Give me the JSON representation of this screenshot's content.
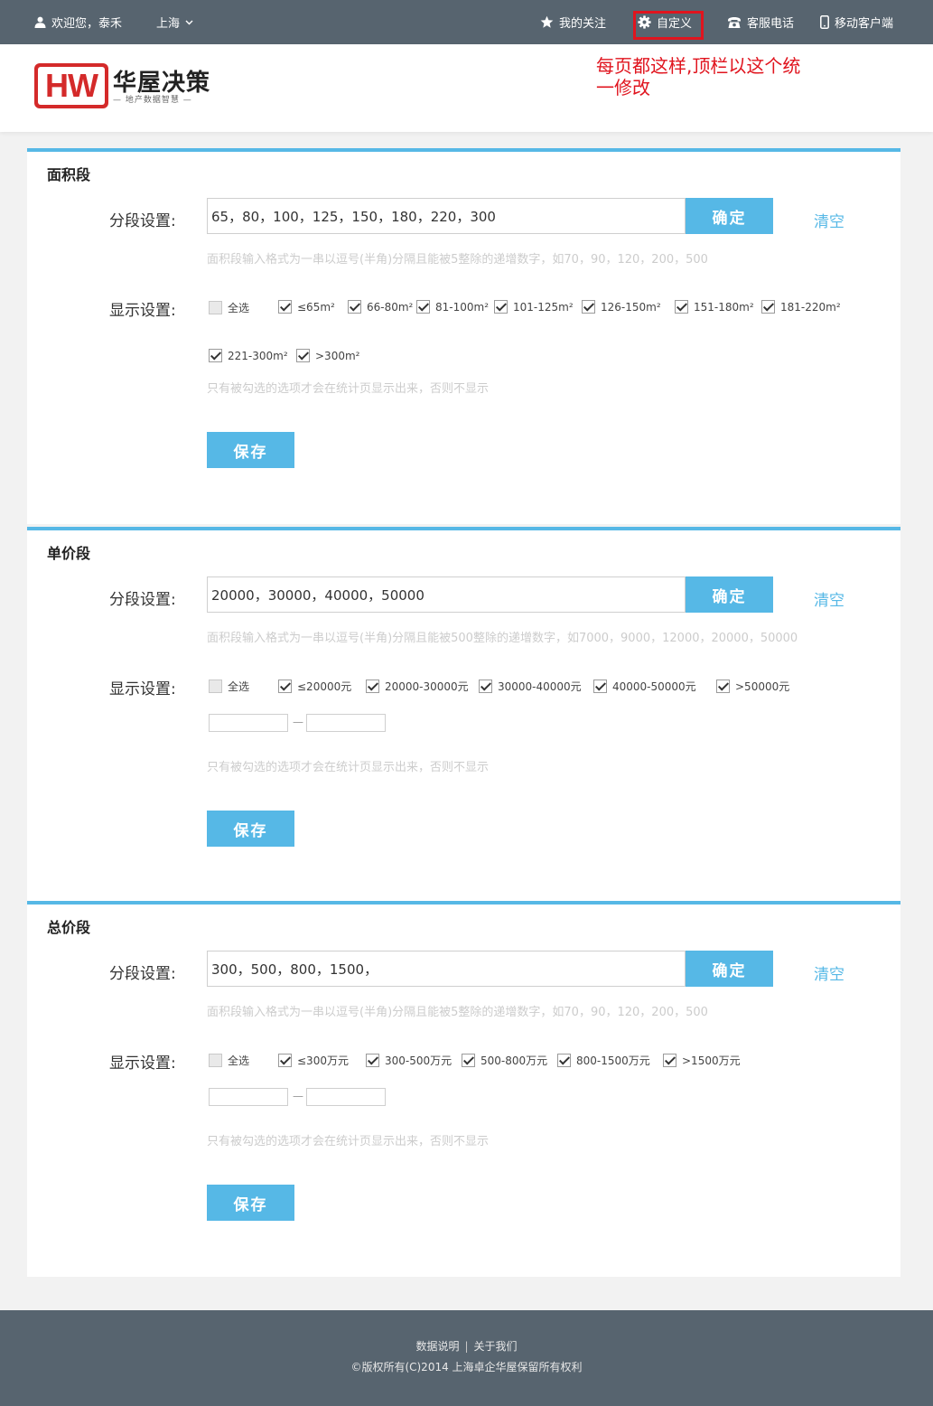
{
  "topbar": {
    "welcome": "欢迎您，泰禾",
    "city": "上海",
    "nav": [
      "我的关注",
      "自定义",
      "客服电话",
      "移动客户端"
    ]
  },
  "header": {
    "logo_letters": "HW",
    "logo_name": "华屋决策",
    "logo_tagline": "— 地产数据智慧 —",
    "annotation": "每页都这样,顶栏以这个统一修改"
  },
  "labels": {
    "segment": "分段设置:",
    "display": "显示设置:",
    "confirm": "确定",
    "clear": "清空",
    "save": "保存",
    "select_all": "全选",
    "dash": "—",
    "display_hint": "只有被勾选的选项才会在统计页显示出来，否则不显示"
  },
  "sections": [
    {
      "title": "面积段",
      "input_value": "65，80，100，125，150，180，220，300",
      "hint": "面积段输入格式为一串以逗号(半角)分隔且能被5整除的递增数字，如70，90，120，200，500",
      "options": [
        "≤65m²",
        "66-80m²",
        "81-100m²",
        "101-125m²",
        "126-150m²",
        "151-180m²",
        "181-220m²",
        "221-300m²",
        ">300m²"
      ]
    },
    {
      "title": "单价段",
      "input_value": "20000，30000，40000，50000",
      "hint": "面积段输入格式为一串以逗号(半角)分隔且能被500整除的递增数字，如7000，9000，12000，20000，50000",
      "options": [
        "≤20000元",
        "20000-30000元",
        "30000-40000元",
        "40000-50000元",
        ">50000元"
      ]
    },
    {
      "title": "总价段",
      "input_value": "300，500，800，1500，",
      "hint": "面积段输入格式为一串以逗号(半角)分隔且能被5整除的递增数字，如70，90，120，200，500",
      "options": [
        "≤300万元",
        "300-500万元",
        "500-800万元",
        "800-1500万元",
        ">1500万元"
      ]
    }
  ],
  "footer": {
    "links": [
      "数据说明",
      "关于我们"
    ],
    "copyright": "©版权所有(C)2014 上海卓企华屋保留所有权利"
  },
  "colors": {
    "accent": "#56b8e6",
    "topbar": "#57646f",
    "highlight_red": "#e0141e"
  }
}
